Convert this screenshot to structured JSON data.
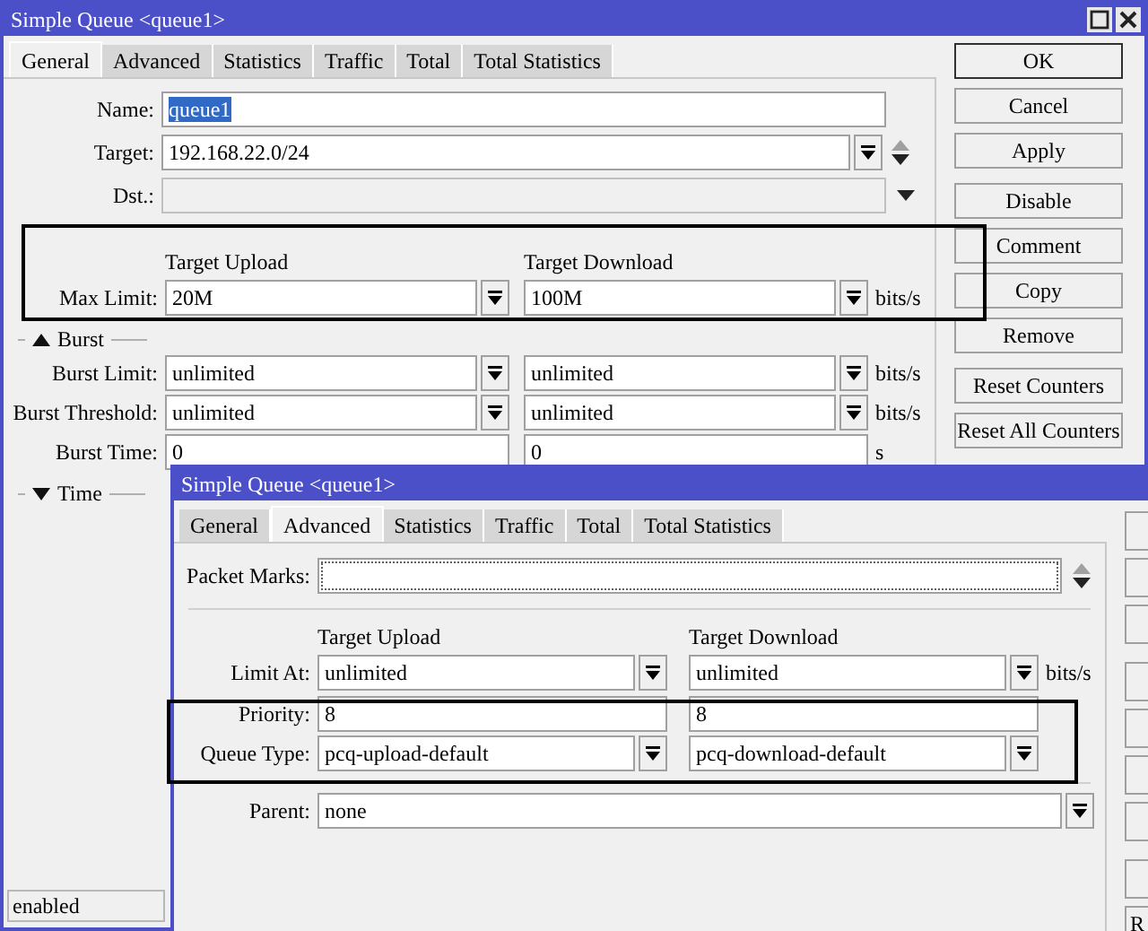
{
  "main_window": {
    "title": "Simple Queue <queue1>",
    "tabs": [
      {
        "label": "General",
        "selected": true
      },
      {
        "label": "Advanced",
        "selected": false
      },
      {
        "label": "Statistics",
        "selected": false
      },
      {
        "label": "Traffic",
        "selected": false
      },
      {
        "label": "Total",
        "selected": false
      },
      {
        "label": "Total Statistics",
        "selected": false
      }
    ],
    "fields": [
      {
        "label": "Name:",
        "value": "queue1",
        "highlighted": true,
        "disabled": false,
        "dropdown": false,
        "reorder": false,
        "arrow": false
      },
      {
        "label": "Target:",
        "value": "192.168.22.0/24",
        "highlighted": false,
        "disabled": false,
        "dropdown": true,
        "reorder": true,
        "arrow": false
      },
      {
        "label": "Dst.:",
        "highlighted": false,
        "disabled": true,
        "dropdown": false,
        "reorder": false,
        "arrow": true
      }
    ],
    "limits": {
      "columns": [
        "Target Upload",
        "Target Download"
      ],
      "rows": [
        {
          "label": "Max Limit:",
          "values": [
            "20M",
            "100M"
          ],
          "dropdown": true,
          "unit": "bits/s"
        }
      ]
    },
    "sections": [
      {
        "label": "Burst",
        "expanded": true,
        "rows": [
          {
            "label": "Burst Limit:",
            "values": [
              "unlimited",
              "unlimited"
            ],
            "dropdown": true,
            "unit": "bits/s"
          },
          {
            "label": "Burst Threshold:",
            "values": [
              "unlimited",
              "unlimited"
            ],
            "dropdown": true,
            "unit": "bits/s"
          },
          {
            "label": "Burst Time:",
            "values": [
              "0",
              "0"
            ],
            "dropdown": false,
            "unit": "s"
          }
        ]
      },
      {
        "label": "Time",
        "expanded": false
      }
    ],
    "button_groups": [
      [
        {
          "label": "OK",
          "default": true
        },
        {
          "label": "Cancel",
          "default": false
        },
        {
          "label": "Apply",
          "default": false
        }
      ],
      [
        {
          "label": "Disable",
          "default": false
        },
        {
          "label": "Comment",
          "default": false
        },
        {
          "label": "Copy",
          "default": false
        },
        {
          "label": "Remove",
          "default": false
        }
      ],
      [
        {
          "label": "Reset Counters",
          "default": false
        },
        {
          "label": "Reset All Counters",
          "default": false
        }
      ]
    ],
    "status_bar": "enabled"
  },
  "overlay_window": {
    "title": "Simple Queue <queue1>",
    "tabs": [
      {
        "label": "General",
        "selected": false
      },
      {
        "label": "Advanced",
        "selected": true
      },
      {
        "label": "Statistics",
        "selected": false
      },
      {
        "label": "Traffic",
        "selected": false
      },
      {
        "label": "Total",
        "selected": false
      },
      {
        "label": "Total Statistics",
        "selected": false
      }
    ],
    "packet_marks": {
      "label": "Packet Marks:",
      "reorder": true
    },
    "limits": {
      "columns": [
        "Target Upload",
        "Target Download"
      ],
      "rows": [
        {
          "label": "Limit At:",
          "values": [
            "unlimited",
            "unlimited"
          ],
          "dropdown": true,
          "unit": "bits/s"
        },
        {
          "label": "Priority:",
          "values": [
            "8",
            "8"
          ],
          "dropdown": false
        },
        {
          "label": "Queue Type:",
          "values": [
            "pcq-upload-default",
            "pcq-download-default"
          ],
          "dropdown": true
        }
      ]
    },
    "parent": {
      "label": "Parent:",
      "value": "none",
      "dropdown": true
    },
    "cut_button_label": "R"
  }
}
